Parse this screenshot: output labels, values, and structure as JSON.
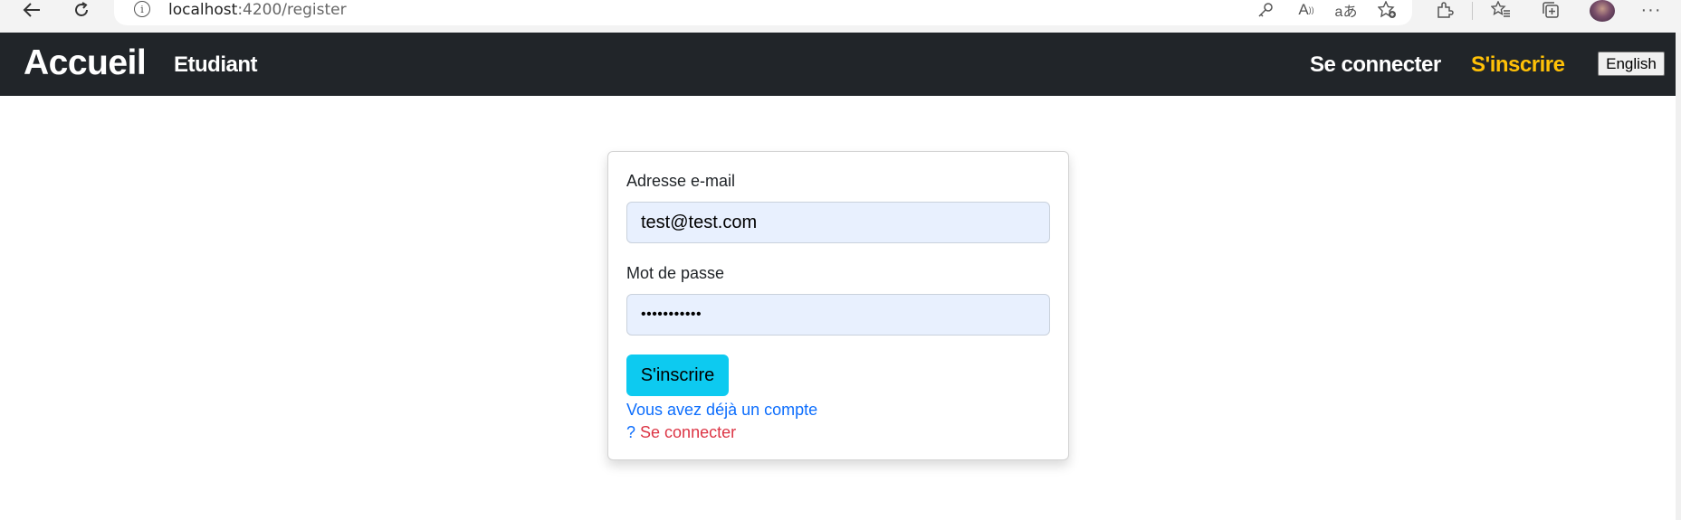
{
  "browser": {
    "url_host": "localhost",
    "url_path": ":4200/register",
    "icons": [
      "back-icon",
      "refresh-icon",
      "info-icon",
      "key-icon",
      "read-aloud-icon",
      "translate-icon",
      "favorite-add-icon",
      "extensions-icon",
      "favorites-icon",
      "collections-icon",
      "profile-avatar",
      "more-icon"
    ]
  },
  "navbar": {
    "brand": "Accueil",
    "student": "Etudiant",
    "login": "Se connecter",
    "register": "S'inscrire",
    "language": "English"
  },
  "form": {
    "email_label": "Adresse e-mail",
    "email_value": "test@test.com",
    "password_label": "Mot de passe",
    "password_value": "•••••••••••",
    "submit_label": "S'inscrire",
    "have_account": "Vous avez déjà un compte",
    "question_mark": "?",
    "login_link": "Se connecter"
  },
  "colors": {
    "navbar_bg": "#212529",
    "active_link": "#ffc107",
    "submit_bg": "#0dcaf0",
    "link_blue": "#0d6efd",
    "link_red": "#dc3545",
    "input_bg": "#e8f0fe"
  }
}
